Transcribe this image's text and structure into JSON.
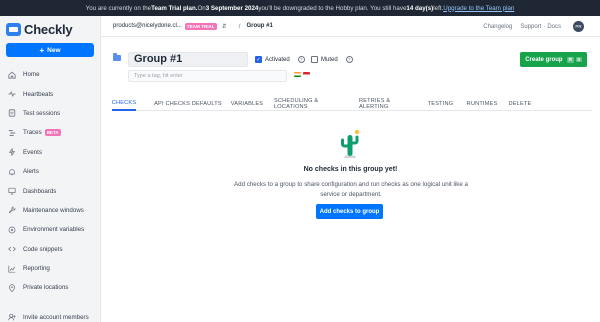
{
  "banner": {
    "p1": "You are currently on the ",
    "p2": "Team Trial plan.",
    "p3": " On ",
    "p4": "3 September 2024",
    "p5": " you'll be downgraded to the Hobby plan. You still have ",
    "p6": "14 day(s)",
    "p7": " left. ",
    "link": "Upgrade to the Team plan"
  },
  "logo": {
    "text": "Checkly"
  },
  "sidebar": {
    "new_label": "New",
    "items": [
      {
        "label": "Home",
        "icon": "home-icon"
      },
      {
        "label": "Heartbeats",
        "icon": "heartbeat-icon"
      },
      {
        "label": "Test sessions",
        "icon": "test-sessions-icon"
      },
      {
        "label": "Traces",
        "icon": "traces-icon",
        "badge": "BETA"
      },
      {
        "label": "Events",
        "icon": "events-icon"
      },
      {
        "label": "Alerts",
        "icon": "alerts-icon"
      },
      {
        "label": "Dashboards",
        "icon": "dashboards-icon"
      },
      {
        "label": "Maintenance windows",
        "icon": "maintenance-icon"
      },
      {
        "label": "Environment variables",
        "icon": "env-variables-icon"
      },
      {
        "label": "Code snippets",
        "icon": "code-icon"
      },
      {
        "label": "Reporting",
        "icon": "reporting-icon"
      },
      {
        "label": "Private locations",
        "icon": "location-icon"
      }
    ],
    "invite": "Invite account members"
  },
  "topbar": {
    "account": "products@nicelydone.cl...",
    "plan_badge": "TEAM TRIAL",
    "breadcrumb": "Group #1",
    "changelog": "Changelog",
    "support": "Support",
    "docs": "Docs",
    "avatar": "PR"
  },
  "group": {
    "name": "Group #1",
    "activated_label": "Activated",
    "muted_label": "Muted",
    "tags_placeholder": "Type a tag, hit enter",
    "create_label": "Create group",
    "create_kbd1": "⌘",
    "create_kbd2": "S"
  },
  "tabs": [
    "CHECKS",
    "API CHECKS DEFAULTS",
    "VARIABLES",
    "SCHEDULING & LOCATIONS",
    "RETRIES & ALERTING",
    "TESTING",
    "RUNTIMES",
    "DELETE"
  ],
  "empty": {
    "title": "No checks in this group yet!",
    "desc": "Add checks to a group to share configuration and run checks as one logical unit like a service or department.",
    "button": "Add checks to group"
  },
  "colors": {
    "primary": "#0075ff",
    "success": "#16a34a",
    "badge": "#f472b6",
    "banner_bg": "#1e2733"
  }
}
